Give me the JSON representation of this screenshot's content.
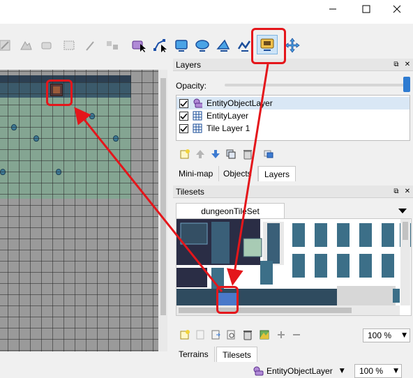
{
  "window": {
    "minimize_icon": "minimize-icon",
    "maximize_icon": "maximize-icon",
    "close_icon": "close-icon"
  },
  "toolbar": {
    "tools": [
      {
        "name": "stamp-brush-icon"
      },
      {
        "name": "terrain-brush-icon"
      },
      {
        "name": "bucket-fill-icon"
      },
      {
        "name": "eraser-icon"
      },
      {
        "name": "rectangular-select-icon"
      },
      {
        "name": "magic-wand-icon"
      },
      {
        "name": "select-same-tile-icon"
      },
      {
        "name": "select-objects-icon"
      },
      {
        "name": "edit-polygons-icon"
      },
      {
        "name": "insert-rectangle-icon"
      },
      {
        "name": "insert-ellipse-icon"
      },
      {
        "name": "insert-polygon-icon"
      },
      {
        "name": "insert-polyline-icon"
      },
      {
        "name": "insert-tile-icon"
      },
      {
        "name": "move-icon"
      }
    ]
  },
  "layers_panel": {
    "title": "Layers",
    "opacity_label": "Opacity:",
    "opacity_value": 1.0,
    "layers": [
      {
        "name": "EntityObjectLayer",
        "visible": true,
        "type": "object-layer-icon"
      },
      {
        "name": "EntityLayer",
        "visible": true,
        "type": "tile-layer-icon"
      },
      {
        "name": "Tile Layer 1",
        "visible": true,
        "type": "tile-layer-icon"
      }
    ],
    "tabs": [
      "Mini-map",
      "Objects",
      "Layers"
    ],
    "active_tab": "Layers"
  },
  "tilesets_panel": {
    "title": "Tilesets",
    "tileset_tab": "dungeonTileSet",
    "zoom": "100 %",
    "tabs": [
      "Terrains",
      "Tilesets"
    ],
    "active_tab": "Tilesets"
  },
  "statusbar": {
    "current_layer": "EntityObjectLayer",
    "zoom": "100 %"
  },
  "colors": {
    "annotation": "#e4161b",
    "selection": "#cde4f7",
    "accent": "#2e7bd1"
  }
}
